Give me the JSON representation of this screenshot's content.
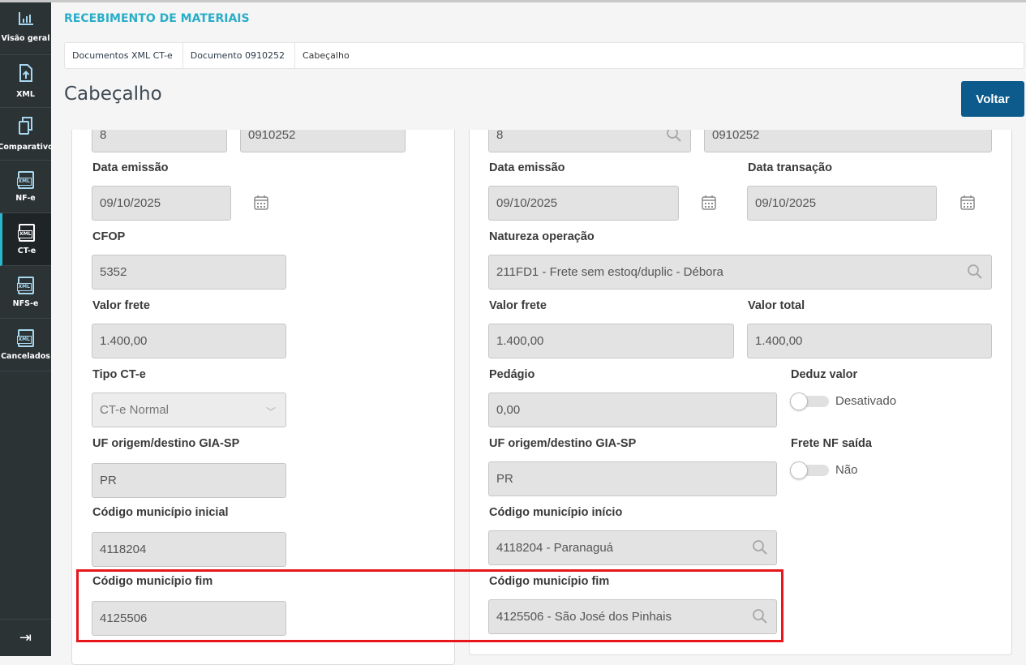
{
  "app_title": "RECEBIMENTO DE MATERIAIS",
  "breadcrumb": [
    "Documentos XML CT-e",
    "Documento 0910252",
    "Cabeçalho"
  ],
  "page_title": "Cabeçalho",
  "back_label": "Voltar",
  "sidebar": {
    "items": [
      {
        "label": "Visão geral",
        "icon": "chart-bar-icon"
      },
      {
        "label": "XML",
        "icon": "file-upload-icon"
      },
      {
        "label": "Comparativo",
        "icon": "copy-icon"
      },
      {
        "label": "NF-e",
        "icon": "xml-file-icon"
      },
      {
        "label": "CT-e",
        "icon": "xml-file-icon",
        "active": true
      },
      {
        "label": "NFS-e",
        "icon": "xml-file-icon"
      },
      {
        "label": "Cancelados",
        "icon": "xml-file-icon"
      }
    ],
    "collapse_icon": "collapse-menu-icon",
    "active_color": "#29b6d1"
  },
  "left": {
    "serie": {
      "value": "8"
    },
    "numero": {
      "value": "0910252"
    },
    "data_emissao": {
      "label": "Data emissão",
      "value": "09/10/2025"
    },
    "cfop": {
      "label": "CFOP",
      "value": "5352"
    },
    "valor_frete": {
      "label": "Valor frete",
      "value": "1.400,00"
    },
    "tipo_cte": {
      "label": "Tipo CT-e",
      "value": "CT-e Normal"
    },
    "uf": {
      "label": "UF origem/destino GIA-SP",
      "value": "PR"
    },
    "mun_inicial": {
      "label": "Código município inicial",
      "value": "4118204"
    },
    "mun_fim": {
      "label": "Código município fim",
      "value": "4125506"
    }
  },
  "right": {
    "serie": {
      "value": "8"
    },
    "numero": {
      "value": "0910252"
    },
    "data_emissao": {
      "label": "Data emissão",
      "value": "09/10/2025"
    },
    "data_transacao": {
      "label": "Data transação",
      "value": "09/10/2025"
    },
    "natureza": {
      "label": "Natureza operação",
      "value": "211FD1 - Frete sem estoq/duplic - Débora"
    },
    "valor_frete": {
      "label": "Valor frete",
      "value": "1.400,00"
    },
    "valor_total": {
      "label": "Valor total",
      "value": "1.400,00"
    },
    "pedagio": {
      "label": "Pedágio",
      "value": "0,00"
    },
    "deduz_valor": {
      "label": "Deduz valor",
      "state": "Desativado",
      "on": false
    },
    "uf": {
      "label": "UF origem/destino GIA-SP",
      "value": "PR"
    },
    "frete_nf_saida": {
      "label": "Frete NF saída",
      "state": "Não",
      "on": false
    },
    "mun_inicio": {
      "label": "Código município início",
      "value": "4118204 - Paranaguá"
    },
    "mun_fim": {
      "label": "Código município fim",
      "value": "4125506 - São José dos Pinhais"
    }
  },
  "highlight_color": "#e8161b"
}
